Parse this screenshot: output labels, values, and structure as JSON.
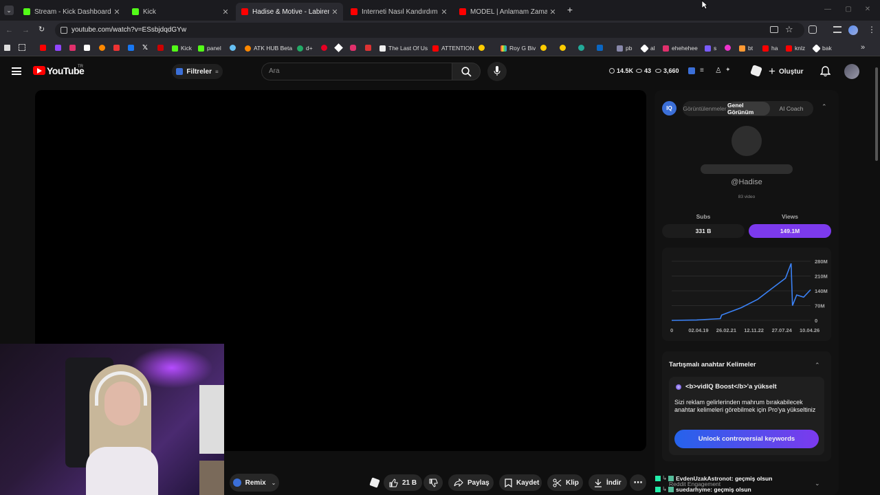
{
  "browser": {
    "tabs": [
      {
        "title": "Stream - Kick Dashboard",
        "favicon": "kick-icon",
        "color": "#53fc18"
      },
      {
        "title": "Kick",
        "favicon": "kick-icon",
        "color": "#53fc18"
      },
      {
        "title": "Hadise & Motive - Labirent (Offi",
        "favicon": "youtube-icon",
        "color": "#ff0000"
      },
      {
        "title": "İnterneti Nasıl Kandırdım - YouT",
        "favicon": "youtube-icon",
        "color": "#ff0000"
      },
      {
        "title": "MODEL | Anlamam Zaman Aldı",
        "favicon": "youtube-icon",
        "color": "#ff0000"
      }
    ],
    "url": "youtube.com/watch?v=ESsbjdqdGYw",
    "bookmarks": [
      "Kick",
      "panel",
      "ATK HUB Beta",
      "d+",
      "The Last Of Us",
      "ATTENTION",
      "Roy G Biv",
      "pb",
      "al",
      "ehehehee",
      "s",
      "bt",
      "ha",
      "knlz",
      "bak"
    ]
  },
  "youtube": {
    "logo_text": "YouTube",
    "region": "TR",
    "filters_label": "Filtreler",
    "search_placeholder": "Ara",
    "stats": {
      "views": "14.5K",
      "likes": "43",
      "comments": "3,660"
    },
    "create_label": "Oluştur"
  },
  "vidiq": {
    "tabs": [
      "Görüntülenmeler",
      "Genel Görünüm",
      "AI Coach"
    ],
    "active_tab": "Genel Görünüm",
    "channel_handle": "@Hadise",
    "video_count": "83 video",
    "subs_label": "Subs",
    "views_label": "Views",
    "subs_value": "331 B",
    "views_value": "149.1M",
    "accent": "#7c3aed",
    "section_title": "Tartışmalı anahtar Kelimeler",
    "boost_title": "<b>vidIQ Boost</b>'a yükselt",
    "boost_desc": "Sizi reklam gelirlerinden mahrum bırakabilecek anahtar kelimeleri görebilmek için Pro'ya yükseltiniz",
    "unlock_label": "Unlock controversial keywords"
  },
  "chart_data": {
    "type": "line",
    "x_ticks": [
      "0",
      "02.04.19",
      "26.02.21",
      "12.11.22",
      "27.07.24",
      "10.04.26"
    ],
    "y_ticks": [
      "280M",
      "210M",
      "140M",
      "70M",
      "0"
    ],
    "ylim": [
      0,
      280
    ],
    "series": [
      {
        "x": [
          0,
          0.18,
          0.35,
          0.36,
          0.5,
          0.62,
          0.72,
          0.82,
          0.86,
          0.87,
          0.9,
          0.95,
          1.0
        ],
        "values": [
          0,
          2,
          8,
          25,
          60,
          100,
          150,
          200,
          270,
          70,
          120,
          110,
          145
        ]
      }
    ],
    "color": "#3b82f6"
  },
  "actions": {
    "remix": "Remix",
    "likes": "21 B",
    "share": "Paylaş",
    "save": "Kaydet",
    "clip": "Klip",
    "download": "İndir"
  },
  "chat": [
    {
      "user": "EvdenUzakAstronot",
      "msg": ": geçmiş olsun"
    },
    {
      "user": "suedarhyme",
      "msg": ": geçmiş olsun"
    }
  ],
  "overlay_text": "Reddit Engagement"
}
